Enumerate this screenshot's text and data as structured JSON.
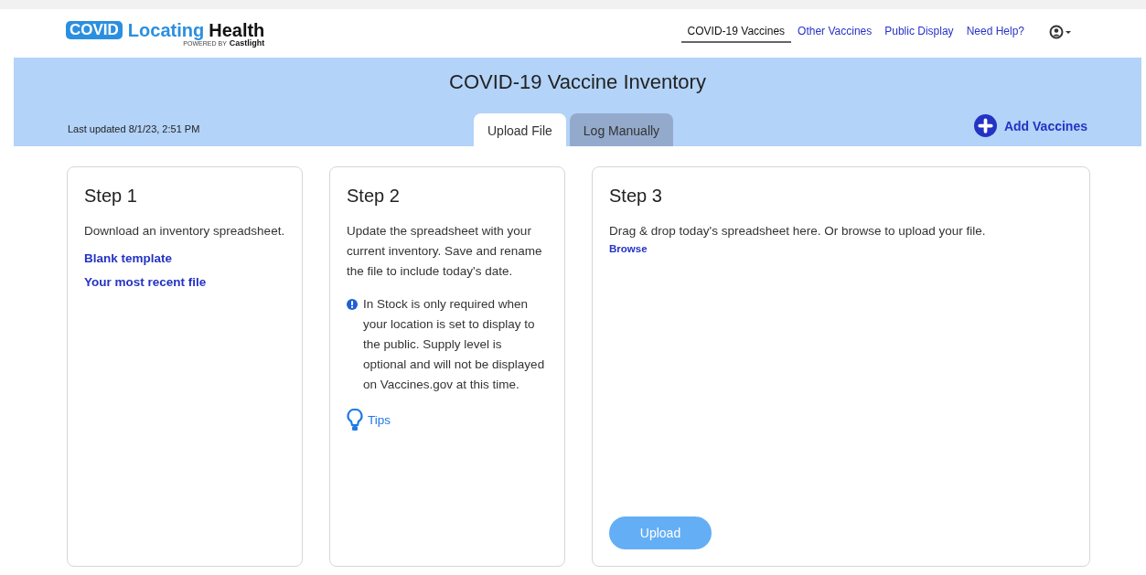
{
  "logo": {
    "badge": "COVID",
    "word1": "Locating",
    "word2": "Health",
    "powered_by": "POWERED BY",
    "brand": "Castlight"
  },
  "nav": [
    {
      "label": "COVID-19 Vaccines",
      "selected": true
    },
    {
      "label": "Other Vaccines",
      "selected": false
    },
    {
      "label": "Public Display",
      "selected": false
    },
    {
      "label": "Need Help?",
      "selected": false
    }
  ],
  "banner": {
    "title": "COVID-19 Vaccine Inventory",
    "last_updated": "Last updated 8/1/23, 2:51 PM",
    "add_button": "Add Vaccines"
  },
  "tabs": [
    {
      "label": "Upload File",
      "selected": true
    },
    {
      "label": "Log Manually",
      "selected": false
    }
  ],
  "steps": [
    {
      "title": "Step 1",
      "text": "Download an inventory spreadsheet.",
      "links": [
        "Blank template",
        "Your most recent file"
      ]
    },
    {
      "title": "Step 2",
      "text": "Update the spreadsheet with your current inventory. Save and rename the file to include today's date.",
      "note": "In Stock is only required when your location is set to display to the public. Supply level is optional and will not be displayed on Vaccines.gov at this time.",
      "tips": "Tips"
    },
    {
      "title": "Step 3",
      "text": "Drag & drop today's spreadsheet here. Or browse to upload your file.",
      "links": [
        "Browse"
      ],
      "button": "Upload"
    }
  ]
}
